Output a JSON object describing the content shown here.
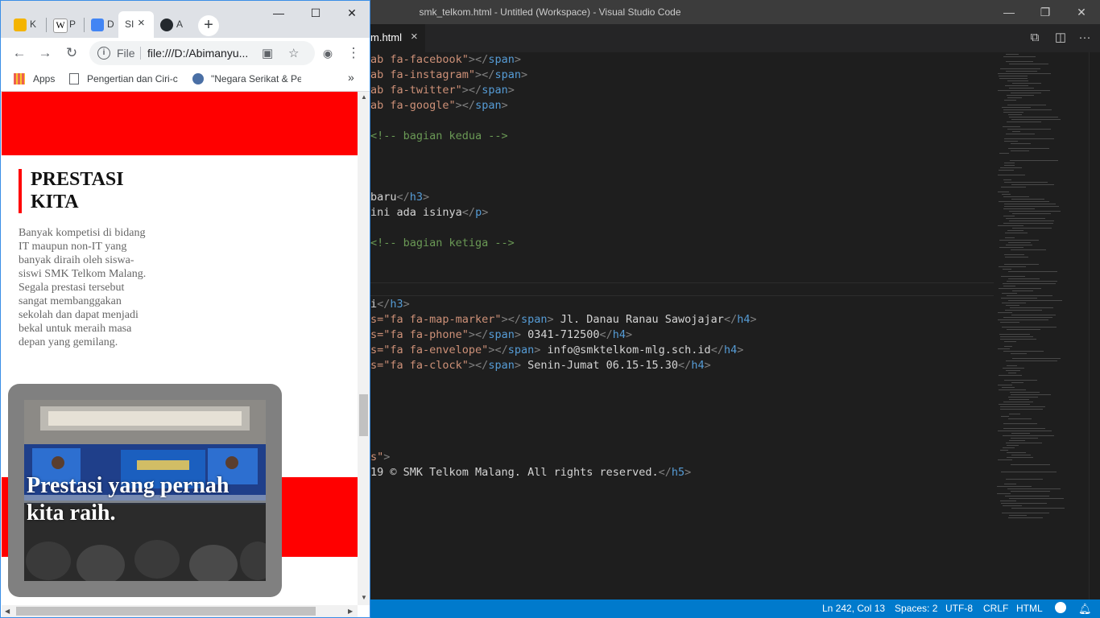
{
  "vscode": {
    "window_title": "smk_telkom.html - Untitled (Workspace) - Visual Studio Code",
    "tab": {
      "label": "m.html",
      "close": "×"
    },
    "window_buttons": {
      "minimize": "—",
      "restore": "❐",
      "close": "✕"
    },
    "code": [
      "ab fa-facebook\"></span>",
      "ab fa-instagram\"></span>",
      "ab fa-twitter\"></span>",
      "ab fa-google\"></span>",
      "<!-- bagian kedua -->",
      "baru</h3>",
      "ini ada isinya</p>",
      "<!-- bagian ketiga -->",
      "i</h3>",
      "s=\"fa fa-map-marker\"></span> Jl. Danau Ranau Sawojajar</h4>",
      "s=\"fa fa-phone\"></span> 0341-712500</h4>",
      "s=\"fa fa-envelope\"></span> info@smktelkom-mlg.sch.id</h4>",
      "s=\"fa fa-clock\"></span> Senin-Jumat 06.15-15.30</h4>",
      "s\">",
      "19 © SMK Telkom Malang. All rights reserved.</h5>"
    ],
    "status_bar": {
      "position": "Ln 242, Col 13",
      "spaces": "Spaces: 2",
      "encoding": "UTF-8",
      "eol": "CRLF",
      "language": "HTML"
    }
  },
  "chrome": {
    "tabs": [
      {
        "title": "K",
        "icon": "classroom-icon",
        "color": "#f4b400"
      },
      {
        "title": "P",
        "icon": "wikipedia-icon",
        "color": "#ffffff"
      },
      {
        "title": "D",
        "icon": "google-docs-icon",
        "color": "#4285f4"
      },
      {
        "title": "SI",
        "icon": "page-icon",
        "color": "#ffffff",
        "active": true
      },
      {
        "title": "A",
        "icon": "github-icon",
        "color": "#24292e"
      }
    ],
    "tab_close": "×",
    "new_tab": "+",
    "window_buttons": {
      "minimize": "—",
      "maximize": "☐",
      "close": "✕"
    },
    "address": {
      "scheme": "File",
      "url": "file:///D:/Abimanyu..."
    },
    "bookmarks": [
      {
        "label": "Apps",
        "icon": "apps-grid-icon"
      },
      {
        "label": "Pengertian dan Ciri-c",
        "icon": "page-icon"
      },
      {
        "label": "\"Negara Serikat & Pe",
        "icon": "site-icon"
      }
    ],
    "bookmarks_overflow": "»"
  },
  "page": {
    "section_title": "PRESTASI KITA",
    "description": "Banyak kompetisi di bidang IT maupun non-IT yang banyak diraih oleh siswa-siswi SMK Telkom Malang. Segala prestasi tersebut sangat membanggakan sekolah dan dapat menjadi bekal untuk meraih masa depan yang gemilang.",
    "photo_caption": "Prestasi yang pernah kita raih.",
    "accent_color": "#ff0000"
  }
}
